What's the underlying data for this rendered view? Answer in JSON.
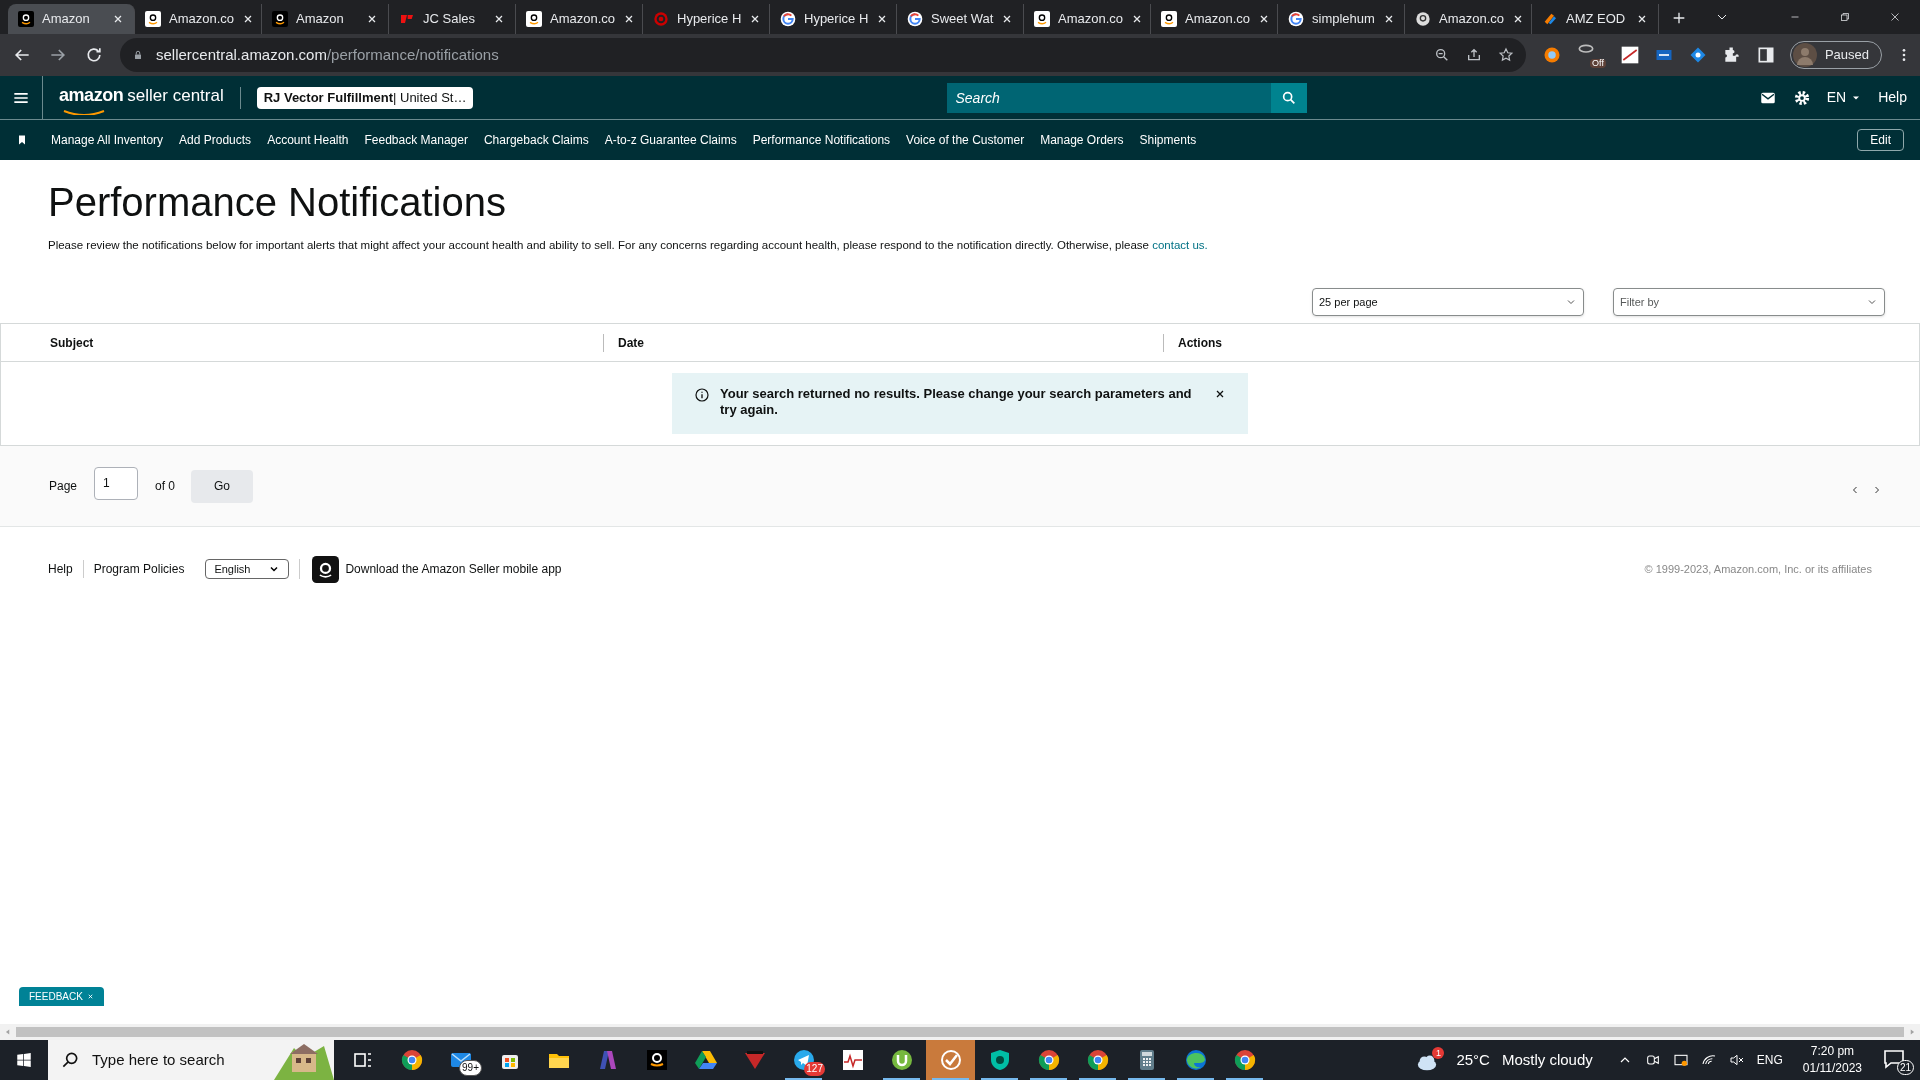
{
  "browser": {
    "tabs": [
      {
        "title": "Amazon",
        "selected": true
      },
      {
        "title": "Amazon.co",
        "selected": false
      },
      {
        "title": "Amazon",
        "selected": false
      },
      {
        "title": "JC Sales",
        "selected": false
      },
      {
        "title": "Amazon.co",
        "selected": false
      },
      {
        "title": "Hyperice H",
        "selected": false
      },
      {
        "title": "Hyperice H",
        "selected": false
      },
      {
        "title": "Sweet Wat",
        "selected": false
      },
      {
        "title": "Amazon.co",
        "selected": false
      },
      {
        "title": "Amazon.co",
        "selected": false
      },
      {
        "title": "simplehum",
        "selected": false
      },
      {
        "title": "Amazon.co",
        "selected": false
      },
      {
        "title": "AMZ EOD",
        "selected": false
      }
    ],
    "url_host": "sellercentral.amazon.com",
    "url_path": "/performance/notifications",
    "extension_badge": "Off",
    "profile": "Paused"
  },
  "header": {
    "logo_word": "amazon",
    "logo_rest": "seller central",
    "account_name": "RJ Vector Fulfillment",
    "account_region": "| United St…",
    "search_placeholder": "Search",
    "language": "EN",
    "help": "Help"
  },
  "nav": {
    "items": [
      "Manage All Inventory",
      "Add Products",
      "Account Health",
      "Feedback Manager",
      "Chargeback Claims",
      "A-to-z Guarantee Claims",
      "Performance Notifications",
      "Voice of the Customer",
      "Manage Orders",
      "Shipments"
    ],
    "edit": "Edit"
  },
  "page": {
    "title": "Performance Notifications",
    "description": "Please review the notifications below for important alerts that might affect your account health and ability to sell. For any concerns regarding account health, please respond to the notification directly. Otherwise, please ",
    "link": "contact us.",
    "per_page": "25 per page",
    "filter_placeholder": "Filter by",
    "columns": [
      "Subject",
      "Date",
      "Actions"
    ],
    "message": "Your search returned no results. Please change your search parameters and try again.",
    "pager": {
      "label": "Page",
      "value": "1",
      "of": "of 0",
      "go": "Go"
    }
  },
  "footer": {
    "links": [
      "Help",
      "Program Policies"
    ],
    "language": "English",
    "app_text": "Download the Amazon Seller mobile app",
    "copyright": "© 1999-2023, Amazon.com, Inc. or its affiliates"
  },
  "feedback": "FEEDBACK",
  "taskbar": {
    "search_placeholder": "Type here to search",
    "apps": [
      {
        "kind": "taskview",
        "running": false
      },
      {
        "kind": "chrome",
        "running": false
      },
      {
        "kind": "mail",
        "running": false,
        "badge": "99+"
      },
      {
        "kind": "store",
        "running": false
      },
      {
        "kind": "folder",
        "running": false
      },
      {
        "kind": "copilot",
        "running": false
      },
      {
        "kind": "amazon",
        "running": false
      },
      {
        "kind": "drive",
        "running": false
      },
      {
        "kind": "triangle",
        "running": false
      },
      {
        "kind": "telegram",
        "running": true,
        "badge": "127"
      },
      {
        "kind": "chart",
        "running": false
      },
      {
        "kind": "torrent",
        "running": true
      },
      {
        "kind": "check",
        "running": true
      },
      {
        "kind": "shield",
        "running": true
      },
      {
        "kind": "chrome",
        "running": true
      },
      {
        "kind": "chrome",
        "running": true
      },
      {
        "kind": "calculator",
        "running": true
      },
      {
        "kind": "edge",
        "running": true
      },
      {
        "kind": "chrome",
        "running": true
      }
    ],
    "weather_badge": "1",
    "temperature": "25°C",
    "weather": "Mostly cloudy",
    "lang": "ENG",
    "time": "7:20 pm",
    "date": "01/11/2023",
    "notifications": "21"
  }
}
